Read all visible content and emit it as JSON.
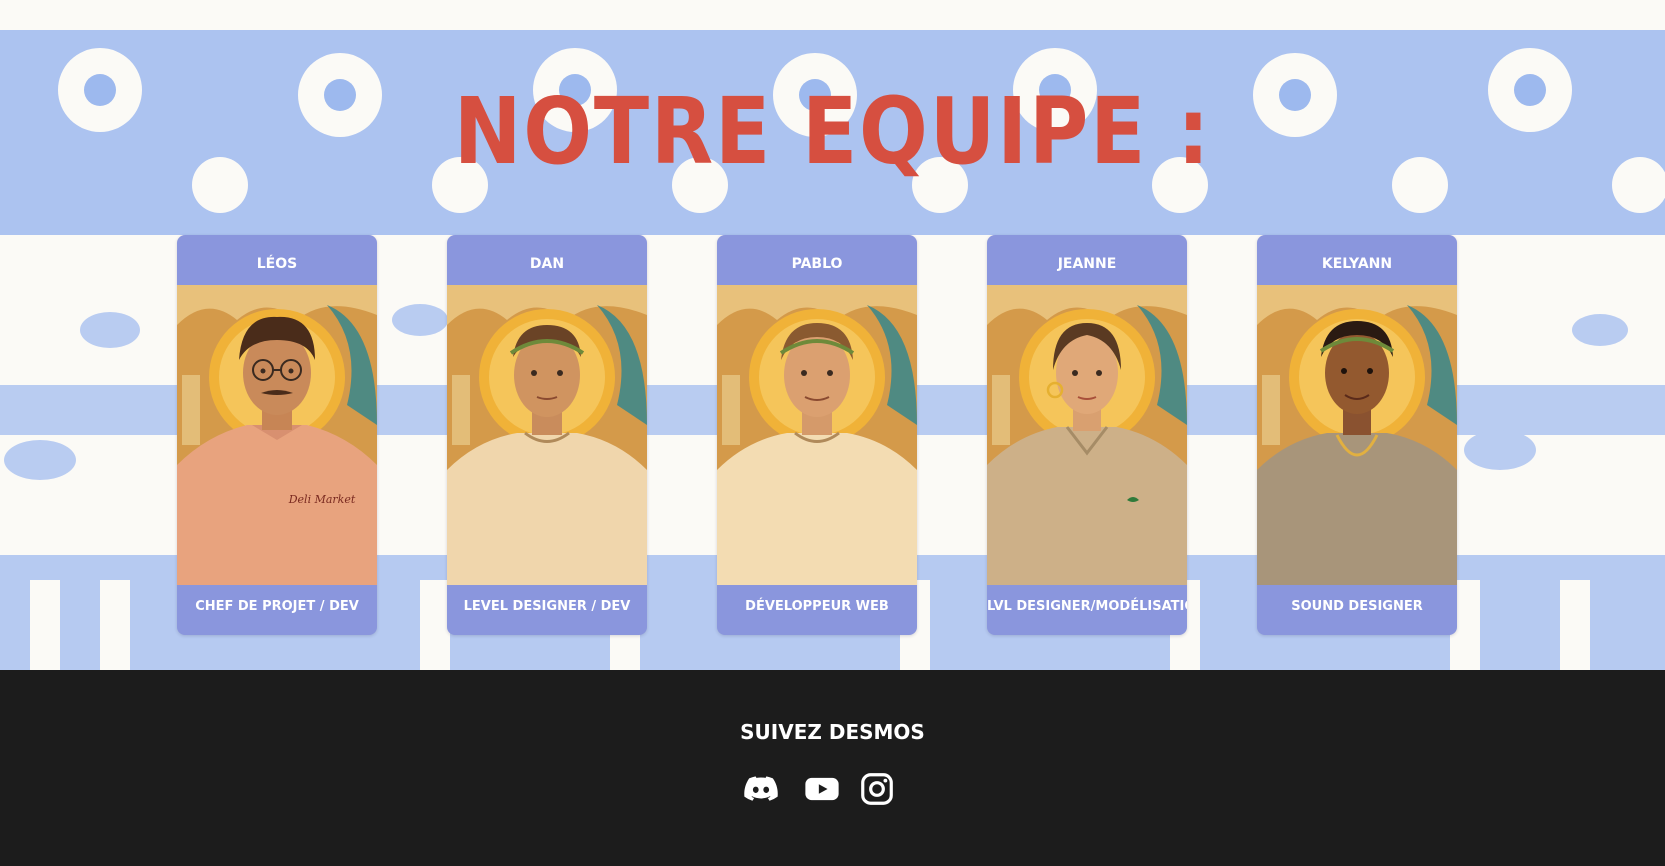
{
  "header": {
    "title": "NOTRE EQUIPE :"
  },
  "team": [
    {
      "name": "LÉOS",
      "role": "CHEF DE PROJET / DEV",
      "shirt_text": "Deli Market"
    },
    {
      "name": "DAN",
      "role": "LEVEL DESIGNER / DEV"
    },
    {
      "name": "PABLO",
      "role": "DÉVELOPPEUR WEB"
    },
    {
      "name": "JEANNE",
      "role": "LVL DESIGNER/MODÉLISATION"
    },
    {
      "name": "KELYANN",
      "role": "SOUND DESIGNER"
    }
  ],
  "footer": {
    "title": "SUIVEZ DESMOS",
    "social": [
      {
        "icon": "discord-icon"
      },
      {
        "icon": "youtube-icon"
      },
      {
        "icon": "instagram-icon"
      }
    ]
  },
  "colors": {
    "title": "#d64f40",
    "card": "#8a96dd",
    "pattern": "#9db9ee",
    "footer": "#1c1c1c"
  }
}
